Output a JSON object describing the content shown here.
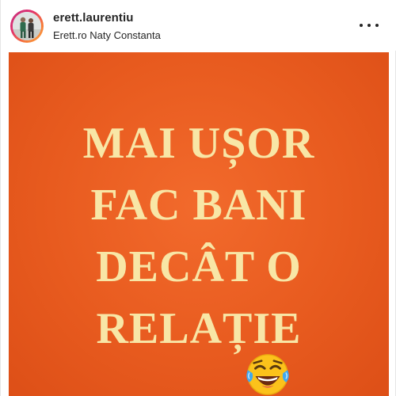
{
  "post": {
    "username": "erett.laurentiu",
    "location": "Erett.ro Naty Constanta",
    "more_icon": "more-horizontal-icon"
  },
  "image": {
    "background_color": "#e85b1f",
    "text_color": "#f8e6a6",
    "headline_lines": [
      "MAI UȘOR",
      "FAC BANI",
      "DECÂT O",
      "RELAȚIE"
    ],
    "emoji": "face-with-tears-of-joy"
  }
}
